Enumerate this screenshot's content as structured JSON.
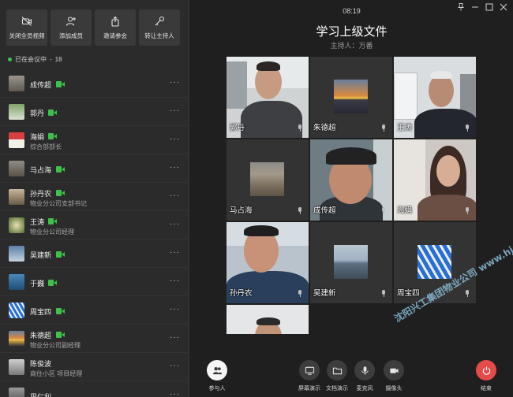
{
  "sidebar": {
    "toolbar": [
      {
        "label": "关闭全员视频",
        "icon": "video-off-icon"
      },
      {
        "label": "添加成员",
        "icon": "add-user-icon"
      },
      {
        "label": "邀请参会",
        "icon": "share-icon"
      },
      {
        "label": "转让主持人",
        "icon": "key-icon"
      }
    ],
    "in_meeting_label": "已在会议中",
    "in_meeting_count": "18",
    "participants": [
      {
        "name": "成传超",
        "subtitle": "",
        "video_on": true
      },
      {
        "name": "郭丹",
        "subtitle": "",
        "video_on": true
      },
      {
        "name": "海娟",
        "subtitle": "综合部部长",
        "video_on": true
      },
      {
        "name": "马占海",
        "subtitle": "",
        "video_on": true
      },
      {
        "name": "孙丹农",
        "subtitle": "物业分公司支部书记",
        "video_on": true
      },
      {
        "name": "王涛",
        "subtitle": "物业分公司经理",
        "video_on": true
      },
      {
        "name": "吴建新",
        "subtitle": "",
        "video_on": true
      },
      {
        "name": "于巍",
        "subtitle": "",
        "video_on": true
      },
      {
        "name": "周宝四",
        "subtitle": "",
        "video_on": true
      },
      {
        "name": "朱德超",
        "subtitle": "物业分公司副经理",
        "video_on": true
      },
      {
        "name": "陈俊波",
        "subtitle": "商住小区 项目经理",
        "video_on": false
      },
      {
        "name": "周仁利",
        "subtitle": "",
        "video_on": false
      }
    ],
    "more_glyph": "···"
  },
  "main": {
    "clock": "08:19",
    "title": "学习上级文件",
    "host": "主持人：万番",
    "tiles": [
      {
        "name": "郭丹",
        "kind": "video"
      },
      {
        "name": "朱德超",
        "kind": "avatar"
      },
      {
        "name": "王涛",
        "kind": "video"
      },
      {
        "name": "马占海",
        "kind": "avatar"
      },
      {
        "name": "成传超",
        "kind": "video"
      },
      {
        "name": "海娟",
        "kind": "video"
      },
      {
        "name": "孙丹农",
        "kind": "video"
      },
      {
        "name": "吴建新",
        "kind": "avatar"
      },
      {
        "name": "周宝四",
        "kind": "avatar"
      },
      {
        "name": "",
        "kind": "video"
      }
    ],
    "bottom_bar": {
      "participants": "参与人",
      "screen_share": "屏幕演示",
      "doc_share": "文档演示",
      "mic": "麦克风",
      "camera": "摄像头",
      "end": "结束"
    },
    "watermark": "沈阳兴工集团物业公司 www.hjgrpby.com"
  },
  "colors": {
    "accent_green": "#3cc24a",
    "end_red": "#e84a4a",
    "tile_bg": "#333333",
    "sidebar_bg": "#2b2b2b"
  }
}
